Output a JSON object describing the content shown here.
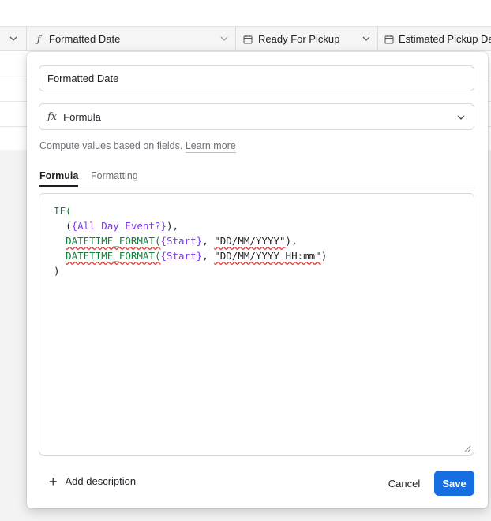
{
  "columns": [
    {
      "label": "",
      "icon": "chevron-down-icon"
    },
    {
      "label": "Formatted Date",
      "icon": "formula-icon"
    },
    {
      "label": "Ready For Pickup",
      "icon": "calendar-icon"
    },
    {
      "label": "Estimated Pickup Da",
      "icon": "calendar-icon"
    }
  ],
  "field_editor": {
    "name_value": "Formatted Date",
    "field_type": "Formula",
    "helper_text": "Compute values based on fields.",
    "learn_more": "Learn more",
    "tabs": [
      {
        "label": "Formula",
        "active": true
      },
      {
        "label": "Formatting",
        "active": false
      }
    ],
    "formula": {
      "if": "IF(",
      "open_paren": "(",
      "field_all_day": "{All Day Event?}",
      "close_paren_comma": "),",
      "fn_datetime": "DATETIME_FORMAT(",
      "field_start": "{Start}",
      "comma_space": ", ",
      "fmt_date": "\"DD/MM/YYYY\"",
      "close_comma": "),",
      "fmt_datetime": "\"DD/MM/YYYY HH:mm\"",
      "close": ")",
      "final_close": ")"
    },
    "add_description": "Add description",
    "cancel_label": "Cancel",
    "save_label": "Save"
  },
  "colors": {
    "accent": "#166ee1",
    "function": "#15803d",
    "field_ref": "#7c3aed"
  }
}
